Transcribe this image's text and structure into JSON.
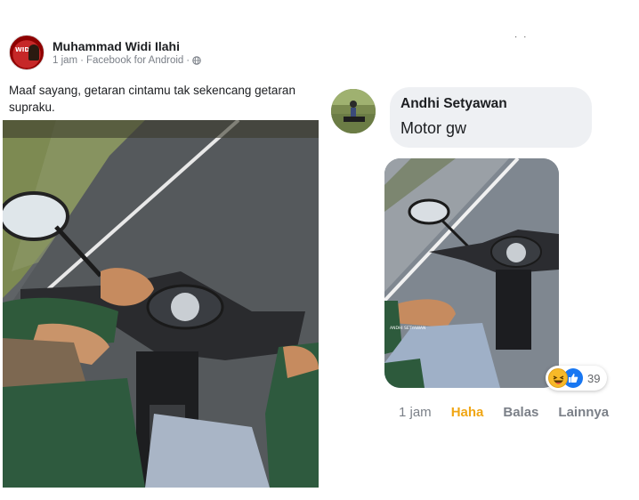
{
  "post": {
    "author": "Muhammad Widi Ilahi",
    "time": "1 jam",
    "source": "Facebook for Android",
    "separator": "·",
    "caption": "Maaf sayang, getaran cintamu tak sekencang getaran supraku.",
    "avatar_text": "WIDI"
  },
  "comment": {
    "author": "Andhi Setyawan",
    "text": "Motor gw",
    "photo_watermark": "ANDHI SETYAWAN",
    "reaction_count": "39",
    "actions": {
      "time": "1 jam",
      "reaction": "Haha",
      "reply": "Balas",
      "more": "Lainnya"
    }
  },
  "top_marks": "· ·",
  "colors": {
    "fb_blue": "#1877f2",
    "haha_yellow": "#f7b928",
    "bubble_gray": "#eef0f3",
    "meta_gray": "#7a7f87"
  },
  "icons": [
    "globe-icon",
    "haha-reaction-icon",
    "like-reaction-icon"
  ]
}
